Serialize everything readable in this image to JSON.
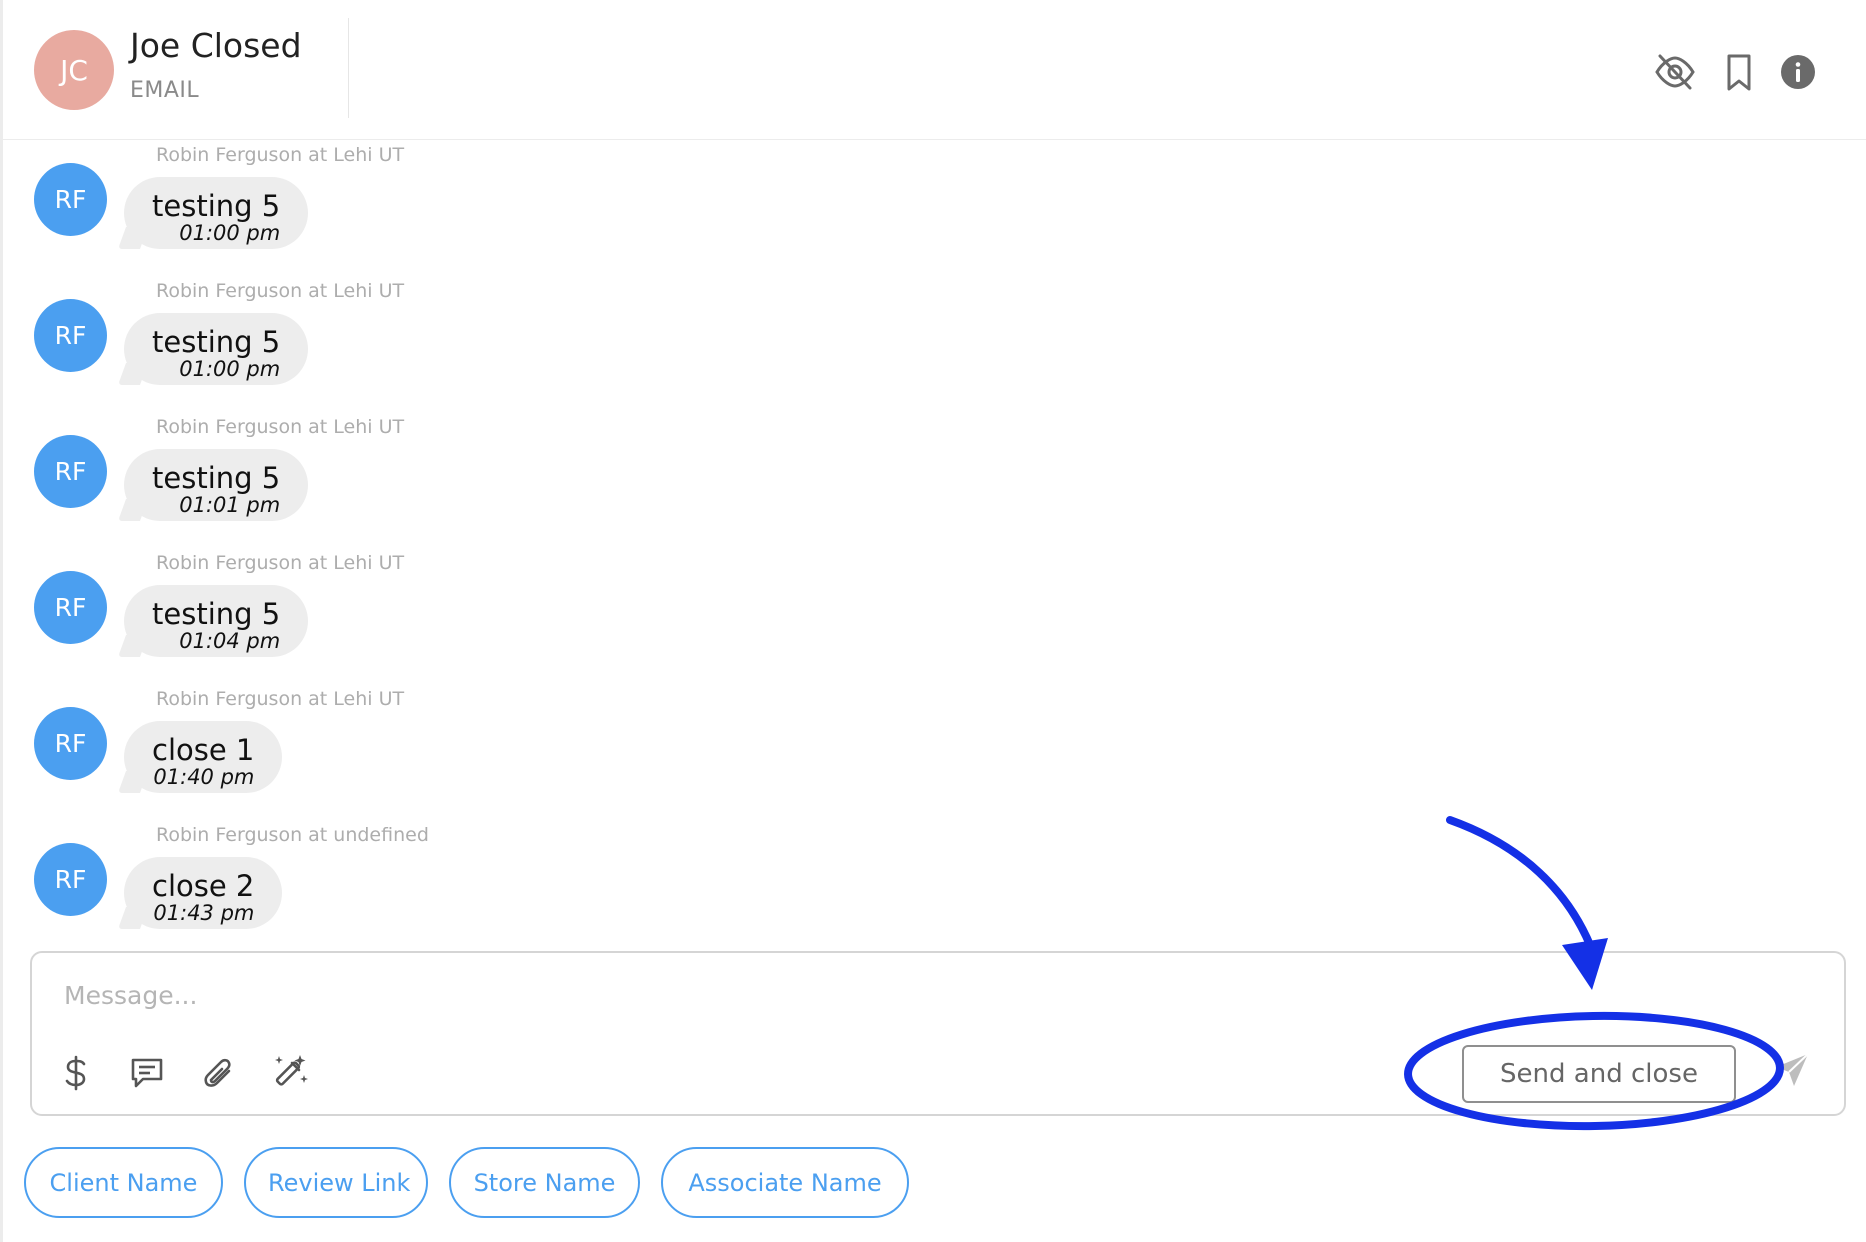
{
  "header": {
    "avatar_initials": "JC",
    "contact_name": "Joe Closed",
    "channel": "EMAIL",
    "avatar_color": "#e8aaa0"
  },
  "icons": {
    "hide": "eye-off-icon",
    "bookmark": "bookmark-icon",
    "info": "info-icon"
  },
  "messages": [
    {
      "avatar": "RF",
      "sender": "Robin Ferguson at Lehi UT",
      "text": "testing 5",
      "time": "01:00 pm"
    },
    {
      "avatar": "RF",
      "sender": "Robin Ferguson at Lehi UT",
      "text": "testing 5",
      "time": "01:00 pm"
    },
    {
      "avatar": "RF",
      "sender": "Robin Ferguson at Lehi UT",
      "text": "testing 5",
      "time": "01:01 pm"
    },
    {
      "avatar": "RF",
      "sender": "Robin Ferguson at Lehi UT",
      "text": "testing 5",
      "time": "01:04 pm"
    },
    {
      "avatar": "RF",
      "sender": "Robin Ferguson at Lehi UT",
      "text": "close 1",
      "time": "01:40 pm"
    },
    {
      "avatar": "RF",
      "sender": "Robin Ferguson at undefined",
      "text": "close 2",
      "time": "01:43 pm"
    }
  ],
  "composer": {
    "placeholder": "Message...",
    "value": "",
    "send_and_close_label": "Send and close"
  },
  "chips": [
    "Client Name",
    "Review Link",
    "Store Name",
    "Associate Name"
  ],
  "colors": {
    "avatar_blue": "#4b9ff0",
    "bubble_gray": "#ededed",
    "annotation_blue": "#1430e6"
  }
}
